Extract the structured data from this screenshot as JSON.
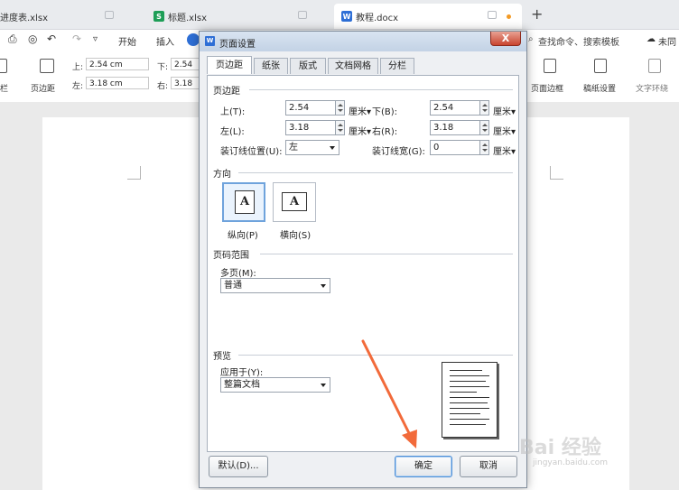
{
  "tabs": [
    {
      "label": "进度表.xlsx",
      "color": "#1e8f4e"
    },
    {
      "label": "标题.xlsx",
      "icon": "S",
      "color": "#1e9e57"
    },
    {
      "label": "教程.docx",
      "icon": "W",
      "color": "#2e6fd6"
    }
  ],
  "ribbon": {
    "start": "开始",
    "insert": "插入",
    "search": "查找命令、搜索模板",
    "cloud": "未同",
    "margin_btn": "页边距",
    "top_label": "上:",
    "top_value": "2.54 cm",
    "bottom_label": "下:",
    "bottom_value": "2.54",
    "left_label": "左:",
    "left_value": "3.18 cm",
    "right_label": "右:",
    "right_value": "3.18",
    "page_border": "页面边框",
    "grid_paper": "稿纸设置",
    "text_env": "文字环绕",
    "left_edge": "栏"
  },
  "dialog": {
    "title": "页面设置",
    "close": "X",
    "tabs": [
      "页边距",
      "纸张",
      "版式",
      "文档网格",
      "分栏"
    ],
    "margin_section": "页边距",
    "top_label": "上(T):",
    "top_value": "2.54",
    "bottom_label": "下(B):",
    "bottom_value": "2.54",
    "left_label": "左(L):",
    "left_value": "3.18",
    "right_label": "右(R):",
    "right_value": "3.18",
    "gutter_pos_label": "装订线位置(U):",
    "gutter_pos_value": "左",
    "gutter_width_label": "装订线宽(G):",
    "gutter_width_value": "0",
    "unit": "厘米",
    "orientation_section": "方向",
    "portrait": "纵向(P)",
    "landscape": "横向(S)",
    "orientation_icon": "A",
    "page_range_section": "页码范围",
    "multi_page_label": "多页(M):",
    "multi_page_value": "普通",
    "preview_section": "预览",
    "apply_label": "应用于(Y):",
    "apply_value": "整篇文档",
    "default_btn": "默认(D)...",
    "ok_btn": "确定",
    "cancel_btn": "取消"
  },
  "annotation_color": "#f26a3a",
  "watermark": {
    "brand": "Bai 经验",
    "url": "jingyan.baidu.com"
  }
}
